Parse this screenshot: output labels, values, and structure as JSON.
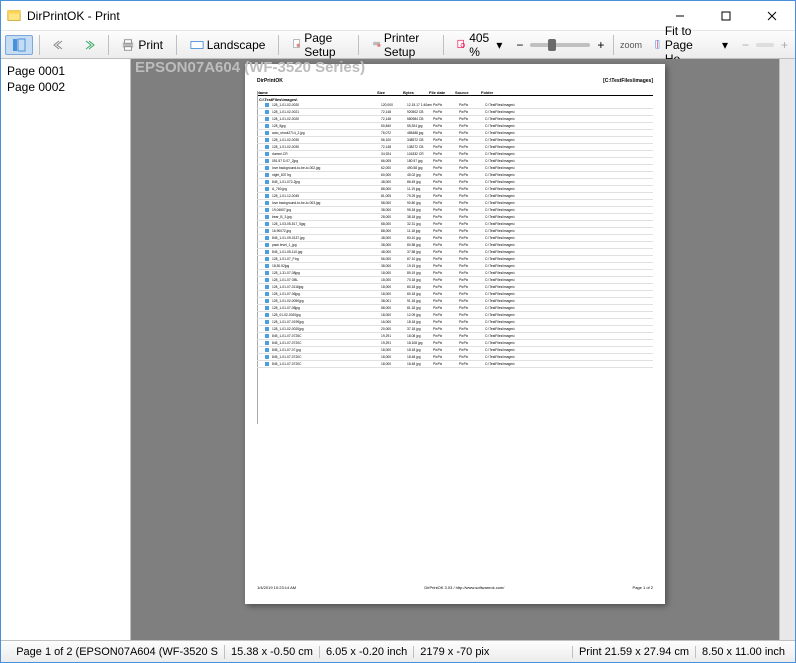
{
  "window": {
    "title": "DirPrintOK - Print"
  },
  "toolbar": {
    "print": "Print",
    "landscape": "Landscape",
    "page_setup": "Page Setup",
    "printer_setup": "Printer Setup",
    "zoom_value": "405 %",
    "zoom_label": "zoom",
    "fit_label": "Fit to Page He..."
  },
  "sidebar": {
    "pages": [
      "Page 0001",
      "Page 0002"
    ]
  },
  "preview": {
    "printer_banner": "EPSON07A604 (WF-3520 Series)",
    "doc_title": "DirPrintOK",
    "doc_path": "[C:\\TestFiles\\images]",
    "columns": [
      "Name",
      "Size",
      "Bytes",
      "File date",
      "Source",
      "Folder"
    ],
    "subhead": "C:\\TestFiles\\images\\",
    "footer_left": "1/4/2019 10:23:14 AM",
    "footer_center": "DirPrintOK 3.03 / http://www.softwareok.com/",
    "footer_right": "Page 1 of 2",
    "rows": [
      {
        "name": "128_1-01-02-0020",
        "size": "120,000",
        "bytes": "12.15.17 1:40am",
        "date": "PixPix",
        "src": "PixPix",
        "folder": "C:\\TestFiles\\images\\"
      },
      {
        "name": "128_1-01-02-0021",
        "size": "72,148",
        "bytes": "920502 CB",
        "date": "PixPix",
        "src": "PixPix",
        "folder": "C:\\TestFiles\\images\\"
      },
      {
        "name": "128_1-01-02-0020",
        "size": "72,148",
        "bytes": "580984 CB",
        "date": "PixPix",
        "src": "PixPix",
        "folder": "C:\\TestFiles\\images\\"
      },
      {
        "name": "128_5jpg",
        "size": "50,840",
        "bytes": "55,924 jpg",
        "date": "PixPix",
        "src": "PixPix",
        "folder": "C:\\TestFiles\\images\\"
      },
      {
        "name": "auto_shoot2714_2.jpg",
        "size": "76,072",
        "bytes": "485488 jpg",
        "date": "PixPix",
        "src": "PixPix",
        "folder": "C:\\TestFiles\\images\\"
      },
      {
        "name": "128_1-01-02-0030",
        "size": "56,100",
        "bytes": "348572 CB",
        "date": "PixPix",
        "src": "PixPix",
        "folder": "C:\\TestFiles\\images\\"
      },
      {
        "name": "128_1-01-02-0030",
        "size": "72,148",
        "bytes": "138272 CB",
        "date": "PixPix",
        "src": "PixPix",
        "folder": "C:\\TestFiles\\images\\"
      },
      {
        "name": "dummi.CR",
        "size": "34,924",
        "bytes": "101832 CR",
        "date": "PixPix",
        "src": "PixPix",
        "folder": "C:\\TestFiles\\images\\"
      },
      {
        "name": "051.57 D.07_2jpg",
        "size": "66,005",
        "bytes": "180.97 jpg",
        "date": "PixPix",
        "src": "PixPix",
        "folder": "C:\\TestFiles\\images\\"
      },
      {
        "name": "love background-to-be-lo-002.jpg",
        "size": "62,000",
        "bytes": "490.58 jpg",
        "date": "PixPix",
        "src": "PixPix",
        "folder": "C:\\TestFiles\\images\\"
      },
      {
        "name": "night_837 bg",
        "size": "60,000",
        "bytes": "45.02 jpg",
        "date": "PixPix",
        "src": "PixPix",
        "folder": "C:\\TestFiles\\images\\"
      },
      {
        "name": "845_1-01-072-2jpg",
        "size": "48,000",
        "bytes": "86.49 jpg",
        "date": "PixPix",
        "src": "PixPix",
        "folder": "C:\\TestFiles\\images\\"
      },
      {
        "name": "A_760.jpg",
        "size": "88,000",
        "bytes": "11.19 jpg",
        "date": "PixPix",
        "src": "PixPix",
        "folder": "C:\\TestFiles\\images\\"
      },
      {
        "name": "128_1-01-12-0045",
        "size": "81,005",
        "bytes": "79.25 jpg",
        "date": "PixPix",
        "src": "PixPix",
        "folder": "C:\\TestFiles\\images\\"
      },
      {
        "name": "love background-to-be-lo-003.jpg",
        "size": "58,000",
        "bytes": "90.80 jpg",
        "date": "PixPix",
        "src": "PixPix",
        "folder": "C:\\TestFiles\\images\\"
      },
      {
        "name": "19,04607.jpg",
        "size": "38,000",
        "bytes": "95.18 jpg",
        "date": "PixPix",
        "src": "PixPix",
        "folder": "C:\\TestFiles\\images\\"
      },
      {
        "name": "bear_B_3.jpg",
        "size": "28,000",
        "bytes": "38.18 jpg",
        "date": "PixPix",
        "src": "PixPix",
        "folder": "C:\\TestFiles\\images\\"
      },
      {
        "name": "128_1-03-05-517_5jpg",
        "size": "68,000",
        "bytes": "32.31 jpg",
        "date": "PixPix",
        "src": "PixPix",
        "folder": "C:\\TestFiles\\images\\"
      },
      {
        "name": "16,90072.jpg",
        "size": "88,000",
        "bytes": "11.18 jpg",
        "date": "PixPix",
        "src": "PixPix",
        "folder": "C:\\TestFiles\\images\\"
      },
      {
        "name": "845_1-01-09-3137.jpg",
        "size": "48,000",
        "bytes": "83.10 jpg",
        "date": "PixPix",
        "src": "PixPix",
        "folder": "C:\\TestFiles\\images\\"
      },
      {
        "name": "pack level_1_jpg",
        "size": "38,000",
        "bytes": "80.58 jpg",
        "date": "PixPix",
        "src": "PixPix",
        "folder": "C:\\TestFiles\\images\\"
      },
      {
        "name": "845_1-01-05-110.jpg",
        "size": "48,000",
        "bytes": "37.58 jpg",
        "date": "PixPix",
        "src": "PixPix",
        "folder": "C:\\TestFiles\\images\\"
      },
      {
        "name": "128_1-01-07_F.bg",
        "size": "56,000",
        "bytes": "87.10 jpg",
        "date": "PixPix",
        "src": "PixPix",
        "folder": "C:\\TestFiles\\images\\"
      },
      {
        "name": "18,50.52jpg",
        "size": "38,000",
        "bytes": "19.19 jpg",
        "date": "PixPix",
        "src": "PixPix",
        "folder": "C:\\TestFiles\\images\\"
      },
      {
        "name": "128_1-31-07-08jpg",
        "size": "18,000",
        "bytes": "89.19 jpg",
        "date": "PixPix",
        "src": "PixPix",
        "folder": "C:\\TestFiles\\images\\"
      },
      {
        "name": "128_1-01-07 OBL",
        "size": "18,000",
        "bytes": "70.18 jpg",
        "date": "PixPix",
        "src": "PixPix",
        "folder": "C:\\TestFiles\\images\\"
      },
      {
        "name": "128_1-01-07-0116jpg",
        "size": "18,000",
        "bytes": "80.18 jpg",
        "date": "PixPix",
        "src": "PixPix",
        "folder": "C:\\TestFiles\\images\\"
      },
      {
        "name": "128_1-01-07-06jpg",
        "size": "18,000",
        "bytes": "80.18 jpg",
        "date": "PixPix",
        "src": "PixPix",
        "folder": "C:\\TestFiles\\images\\"
      },
      {
        "name": "128_1-01-02-0050jpg",
        "size": "38,001",
        "bytes": "91.18 jpg",
        "date": "PixPix",
        "src": "PixPix",
        "folder": "C:\\TestFiles\\images\\"
      },
      {
        "name": "128_1-01-07-08jpg",
        "size": "58,000",
        "bytes": "81.18 jpg",
        "date": "PixPix",
        "src": "PixPix",
        "folder": "C:\\TestFiles\\images\\"
      },
      {
        "name": "128_01-02-0020jpg",
        "size": "18,000",
        "bytes": "12.09 jpg",
        "date": "PixPix",
        "src": "PixPix",
        "folder": "C:\\TestFiles\\images\\"
      },
      {
        "name": "128_1-01-07-0199jpg",
        "size": "16,000",
        "bytes": "18.18 jpg",
        "date": "PixPix",
        "src": "PixPix",
        "folder": "C:\\TestFiles\\images\\"
      },
      {
        "name": "128_1-01-02-0020jpg",
        "size": "20,000",
        "bytes": "37.18 jpg",
        "date": "PixPix",
        "src": "PixPix",
        "folder": "C:\\TestFiles\\images\\"
      },
      {
        "name": "845_1-01-07-0725C",
        "size": "19,291",
        "bytes": "18.08 jpg",
        "date": "PixPix",
        "src": "PixPix",
        "folder": "C:\\TestFiles\\images\\"
      },
      {
        "name": "845_1-01-07-0720C",
        "size": "19,291",
        "bytes": "18.108 jpg",
        "date": "PixPix",
        "src": "PixPix",
        "folder": "C:\\TestFiles\\images\\"
      },
      {
        "name": "845_1-01-07-07.jpg",
        "size": "18,000",
        "bytes": "18.18 jpg",
        "date": "PixPix",
        "src": "PixPix",
        "folder": "C:\\TestFiles\\images\\"
      },
      {
        "name": "845_1-01-07-0720C",
        "size": "18,000",
        "bytes": "18.48 jpg",
        "date": "PixPix",
        "src": "PixPix",
        "folder": "C:\\TestFiles\\images\\"
      },
      {
        "name": "845_1-01-07-0720C",
        "size": "18,000",
        "bytes": "18.48 jpg",
        "date": "PixPix",
        "src": "PixPix",
        "folder": "C:\\TestFiles\\images\\"
      }
    ]
  },
  "status": {
    "page_info": "Page 1 of 2 (EPSON07A604 (WF-3520 S",
    "cm": "15.38 x -0.50 cm",
    "inch": "6.05 x -0.20 inch",
    "pix": "2179 x -70 pix",
    "print_cm": "Print 21.59 x 27.94 cm",
    "print_in": "8.50 x 11.00 inch"
  }
}
